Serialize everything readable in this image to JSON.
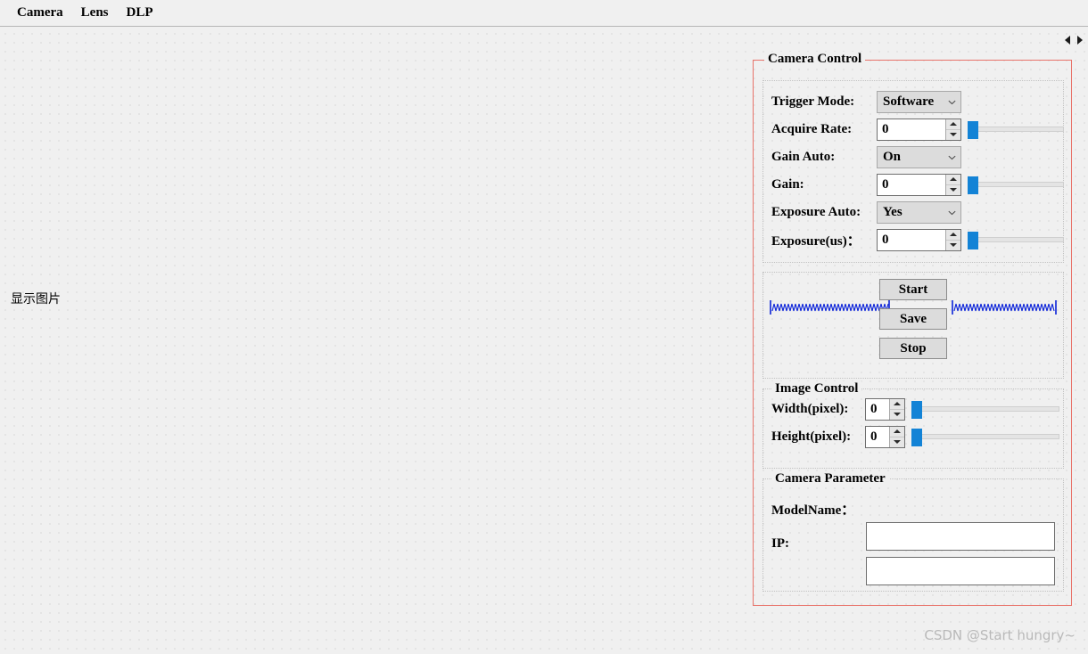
{
  "menubar": {
    "items": [
      {
        "label": "Camera",
        "name": "menu-camera"
      },
      {
        "label": "Lens",
        "name": "menu-lens"
      },
      {
        "label": "DLP",
        "name": "menu-dlp"
      }
    ]
  },
  "nav": {
    "prev_icon": "arrow-left-icon",
    "next_icon": "arrow-right-icon"
  },
  "canvas": {
    "display_image_label": "显示图片"
  },
  "panel": {
    "title": "Camera Control",
    "border_color": "#e8736a"
  },
  "camera_control": {
    "rows": [
      {
        "label": "Trigger Mode:",
        "type": "combo",
        "value": "Software"
      },
      {
        "label": "Acquire Rate:",
        "type": "spin",
        "value": "0",
        "slider": 0
      },
      {
        "label": "Gain Auto:",
        "type": "combo",
        "value": "On"
      },
      {
        "label": "Gain:",
        "type": "spin",
        "value": "0",
        "slider": 0
      },
      {
        "label": "Exposure Auto:",
        "type": "combo",
        "value": "Yes"
      },
      {
        "label": "Exposure(us)：",
        "type": "spin",
        "value": "0",
        "slider": 0
      }
    ]
  },
  "actions": {
    "start_label": "Start",
    "save_label": "Save",
    "stop_label": "Stop",
    "spacer_color": "#0a22d8"
  },
  "image_control": {
    "title": "Image Control",
    "rows": [
      {
        "label": "Width(pixel):",
        "value": "0",
        "slider": 0
      },
      {
        "label": "Height(pixel):",
        "value": "0",
        "slider": 0
      }
    ]
  },
  "camera_parameter": {
    "title": "Camera Parameter",
    "rows": [
      {
        "label": "ModelName：",
        "value": "",
        "placeholder": ""
      },
      {
        "label": "IP:",
        "value": "",
        "placeholder": ""
      }
    ]
  },
  "watermark": {
    "text": "CSDN @Start hungry~"
  },
  "colors": {
    "background": "#f0f0f0",
    "accent_blue": "#1383d6",
    "panel_red": "#e8736a",
    "grid_dot": "#c9c9c9"
  }
}
